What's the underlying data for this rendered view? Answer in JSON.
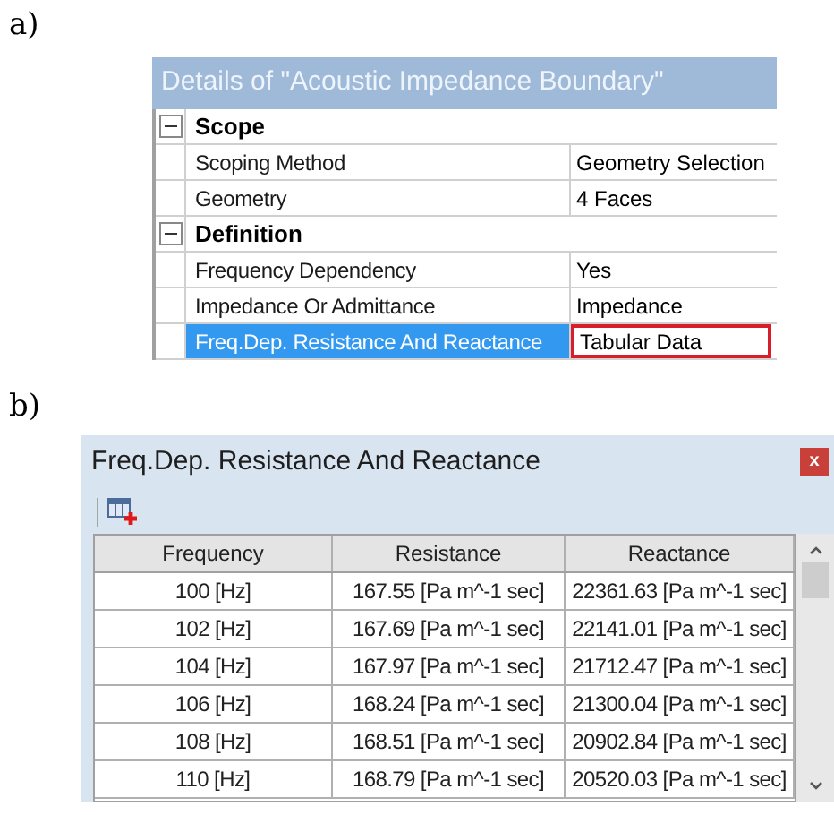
{
  "figure_labels": [
    "a)",
    "b)"
  ],
  "details_panel": {
    "title": "Details of \"Acoustic Impedance Boundary\"",
    "sections": [
      {
        "label": "Scope",
        "expanded": true,
        "rows": [
          {
            "name": "Scoping Method",
            "value": "Geometry Selection",
            "selected": false,
            "highlighted": false
          },
          {
            "name": "Geometry",
            "value": "4 Faces",
            "selected": false,
            "highlighted": false
          }
        ]
      },
      {
        "label": "Definition",
        "expanded": true,
        "rows": [
          {
            "name": "Frequency Dependency",
            "value": "Yes",
            "selected": false,
            "highlighted": false
          },
          {
            "name": "Impedance Or Admittance",
            "value": "Impedance",
            "selected": false,
            "highlighted": false
          },
          {
            "name": "Freq.Dep. Resistance And Reactance",
            "value": "Tabular Data",
            "selected": true,
            "highlighted": true
          }
        ]
      }
    ]
  },
  "table_window": {
    "title": "Freq.Dep. Resistance And Reactance",
    "close": "x",
    "columns": [
      "Frequency",
      "Resistance",
      "Reactance"
    ],
    "rows": [
      [
        "100 [Hz]",
        "167.55 [Pa m^-1 sec]",
        "22361.63 [Pa m^-1 sec]"
      ],
      [
        "102 [Hz]",
        "167.69 [Pa m^-1 sec]",
        "22141.01 [Pa m^-1 sec]"
      ],
      [
        "104 [Hz]",
        "167.97 [Pa m^-1 sec]",
        "21712.47 [Pa m^-1 sec]"
      ],
      [
        "106 [Hz]",
        "168.24 [Pa m^-1 sec]",
        "21300.04 [Pa m^-1 sec]"
      ],
      [
        "108 [Hz]",
        "168.51 [Pa m^-1 sec]",
        "20902.84 [Pa m^-1 sec]"
      ],
      [
        "110 [Hz]",
        "168.79 [Pa m^-1 sec]",
        "20520.03 [Pa m^-1 sec]"
      ]
    ]
  }
}
